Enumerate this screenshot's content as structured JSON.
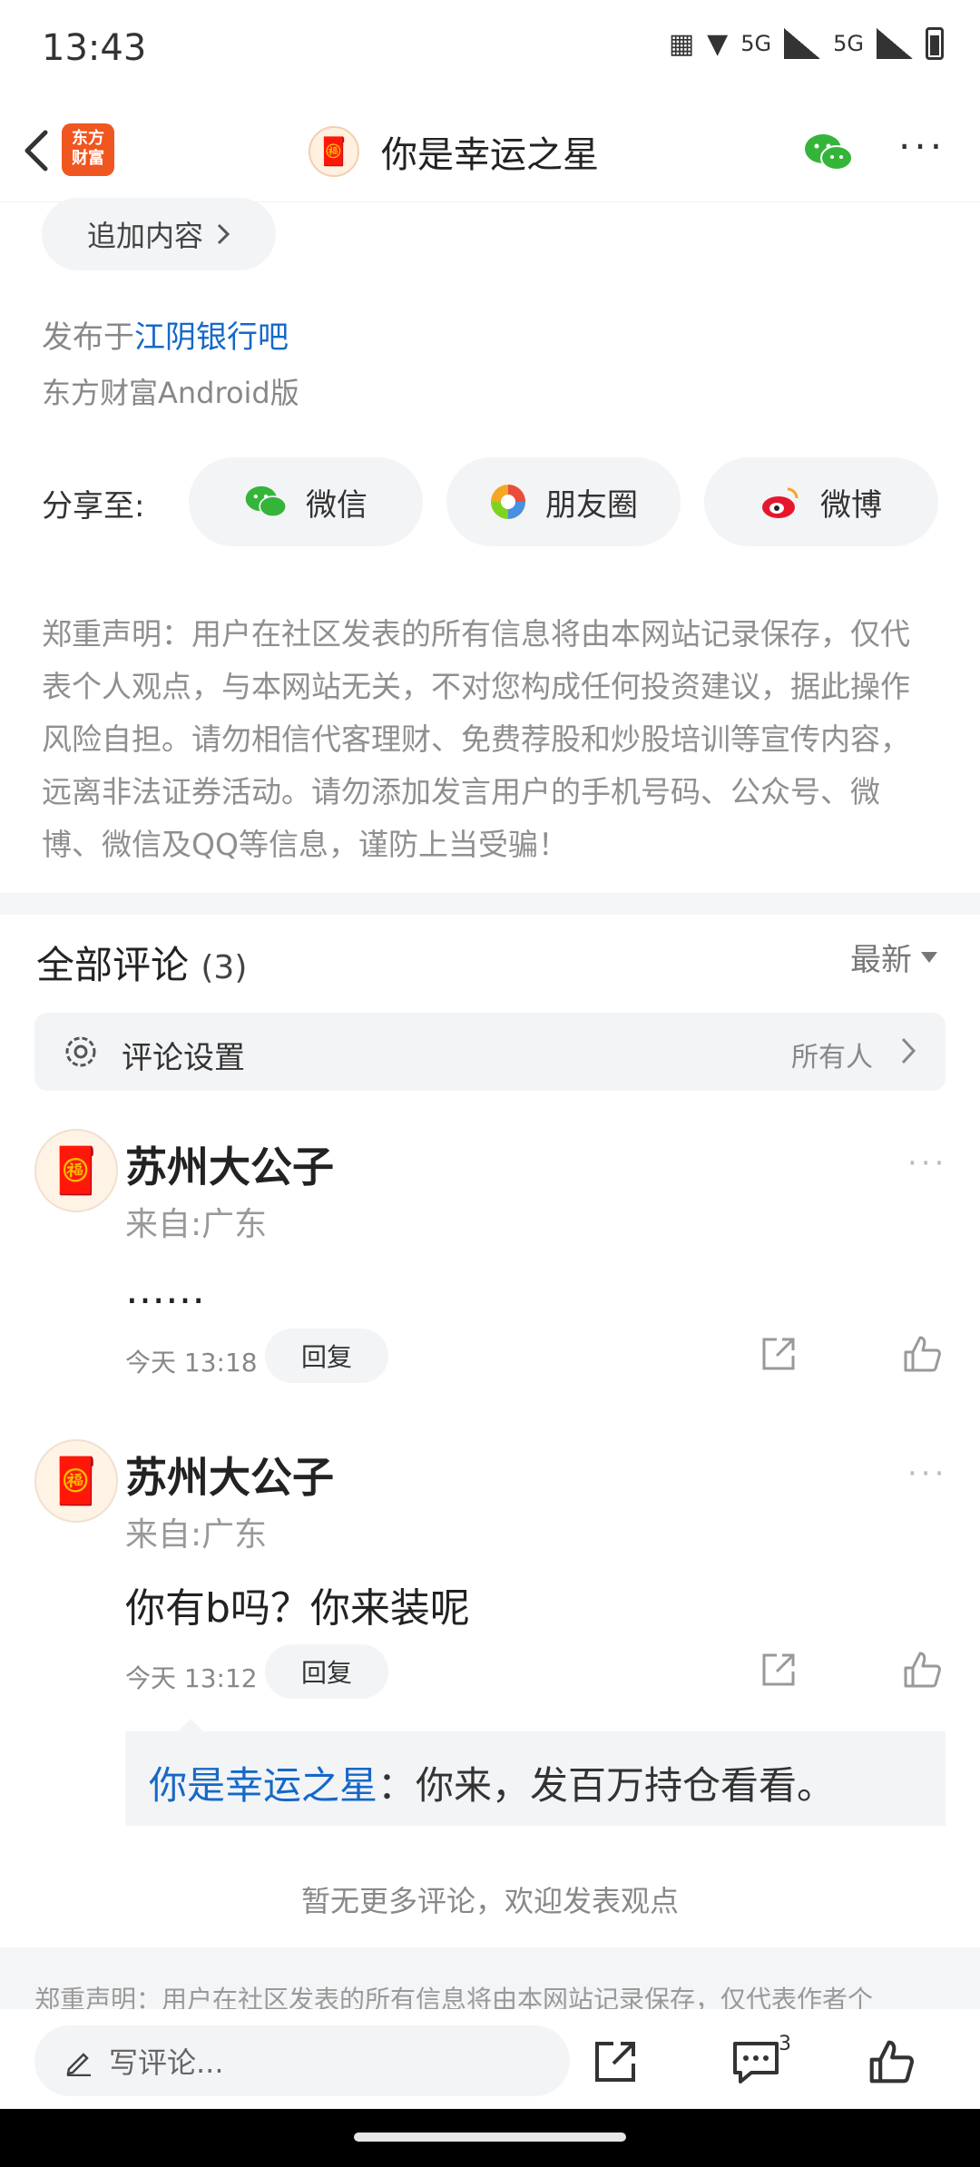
{
  "status_bar": {
    "time": "13:43",
    "net1": "5G",
    "net2": "5G"
  },
  "header": {
    "logo_line1": "东方",
    "logo_line2": "财富",
    "title": "你是幸运之星"
  },
  "post": {
    "add_content": "追加内容",
    "published_prefix": "发布于",
    "board": "江阴银行吧",
    "client": "东方财富Android版"
  },
  "share": {
    "label": "分享至:",
    "options": [
      "微信",
      "朋友圈",
      "微博"
    ]
  },
  "disclaimer": "郑重声明：用户在社区发表的所有信息将由本网站记录保存，仅代表个人观点，与本网站无关，不对您构成任何投资建议，据此操作风险自担。请勿相信代客理财、免费荐股和炒股培训等宣传内容，远离非法证券活动。请勿添加发言用户的手机号码、公众号、微博、微信及QQ等信息，谨防上当受骗！",
  "comments": {
    "title": "全部评论",
    "count": "(3)",
    "sort": "最新",
    "settings_label": "评论设置",
    "settings_value": "所有人",
    "items": [
      {
        "user": "苏州大公子",
        "from": "来自:广东",
        "text": "……",
        "time": "今天 13:18",
        "reply": "回复"
      },
      {
        "user": "苏州大公子",
        "from": "来自:广东",
        "text": "你有b吗？你来装呢",
        "time": "今天 13:12",
        "reply": "回复"
      }
    ],
    "quote_user": "你是幸运之星",
    "quote_text": "：你来，发百万持仓看看。",
    "no_more": "暂无更多评论，欢迎发表观点"
  },
  "footer_disclaimer": "郑重声明：用户在社区发表的所有信息将由本网站记录保存，仅代表作者个",
  "bottom_bar": {
    "write_placeholder": "写评论...",
    "comment_badge": "3"
  }
}
